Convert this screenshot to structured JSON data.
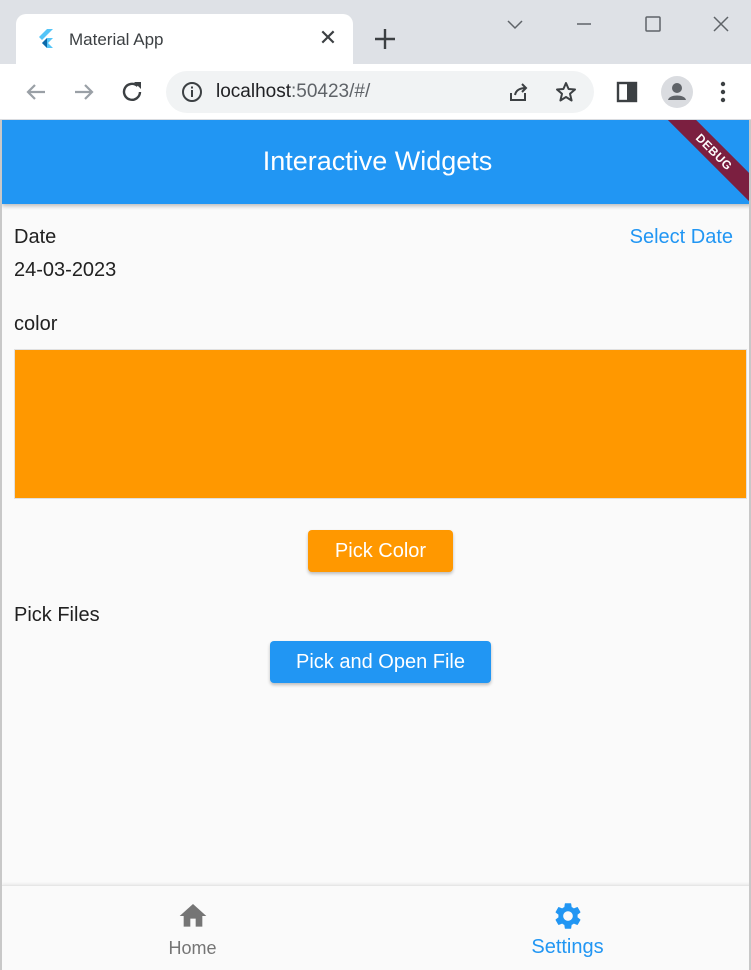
{
  "browser": {
    "tab_title": "Material App",
    "url_host": "localhost",
    "url_rest": ":50423/#/"
  },
  "app": {
    "title": "Interactive Widgets",
    "debug_label": "DEBUG",
    "date": {
      "label": "Date",
      "value": "24-03-2023",
      "select_label": "Select Date"
    },
    "color": {
      "label": "color",
      "swatch_color": "#ff9800",
      "pick_button_label": "Pick Color"
    },
    "files": {
      "label": "Pick Files",
      "button_label": "Pick and Open File"
    },
    "bottom_nav": {
      "items": [
        {
          "label": "Home",
          "icon": "home-icon",
          "selected": false
        },
        {
          "label": "Settings",
          "icon": "gear-icon",
          "selected": true
        }
      ]
    },
    "colors": {
      "primary": "#2196f3",
      "accent": "#ff9800",
      "unselected": "#757575"
    }
  }
}
